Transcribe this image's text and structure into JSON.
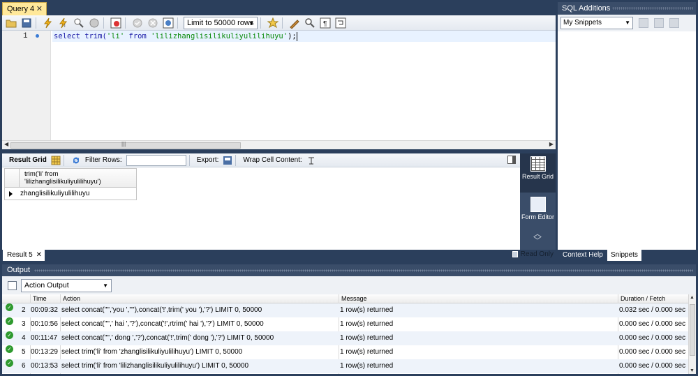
{
  "query_tab": {
    "label": "Query 4",
    "close": "✕"
  },
  "toolbar": {
    "limit_label": "Limit to 50000 rows",
    "icons": [
      "open-folder-icon",
      "save-icon",
      "execute-icon",
      "execute-current-icon",
      "explain-icon",
      "stop-icon",
      "toggle-error-icon",
      "commit-icon",
      "rollback-icon",
      "autocommit-icon",
      "beautify-icon",
      "find-icon",
      "invisible-chars-icon",
      "wrap-icon"
    ]
  },
  "editor": {
    "line_number": "1",
    "code": {
      "kw1": "select",
      "fn": " trim(",
      "s1": "'li'",
      "kw2": " from ",
      "s2": "'lilizhanglisilikuliyulilihuyu'",
      "tail": ");"
    }
  },
  "result_toolbar": {
    "result_grid": "Result Grid",
    "filter_rows": "Filter Rows:",
    "export": "Export:",
    "wrap_cell": "Wrap Cell Content:"
  },
  "result_grid": {
    "column_header": "trim('li' from 'lilizhanglisilikuliyulilihuyu')",
    "rows": [
      "zhanglisilikuliyulilihuyu"
    ]
  },
  "side_panel": {
    "result_grid_label": "Result Grid",
    "form_editor_label": "Form Editor"
  },
  "result_tab": {
    "label": "Result 5",
    "close": "✕",
    "read_only": "Read Only"
  },
  "sql_additions": {
    "title": "SQL Additions",
    "snippet_select": "My Snippets",
    "tab_context": "Context Help",
    "tab_snippets": "Snippets"
  },
  "output": {
    "title": "Output",
    "select": "Action Output",
    "headers": {
      "time": "Time",
      "action": "Action",
      "message": "Message",
      "duration": "Duration / Fetch"
    },
    "rows": [
      {
        "n": "2",
        "time": "00:09:32",
        "action": "select concat('\"','you ','\"'),concat('!',trim(' you '),'?') LIMIT 0, 50000",
        "message": "1 row(s) returned",
        "duration": "0.032 sec / 0.000 sec"
      },
      {
        "n": "3",
        "time": "00:10:56",
        "action": "select concat('\"',' hai ','?'),concat('!',rtrim(' hai '),'?') LIMIT 0, 50000",
        "message": "1 row(s) returned",
        "duration": "0.000 sec / 0.000 sec"
      },
      {
        "n": "4",
        "time": "00:11:47",
        "action": "select concat('\"',' dong ','?'),concat('!',trim(' dong '),'?') LIMIT 0, 50000",
        "message": "1 row(s) returned",
        "duration": "0.000 sec / 0.000 sec"
      },
      {
        "n": "5",
        "time": "00:13:29",
        "action": "select trim('li' from 'zhanglisilikuliyulilihuyu') LIMIT 0, 50000",
        "message": "1 row(s) returned",
        "duration": "0.000 sec / 0.000 sec"
      },
      {
        "n": "6",
        "time": "00:13:53",
        "action": "select trim('li' from 'lilizhanglisilikuliyulilihuyu') LIMIT 0, 50000",
        "message": "1 row(s) returned",
        "duration": "0.000 sec / 0.000 sec"
      }
    ]
  },
  "colors": {
    "frame": "#2b3f5c",
    "panel_header": "#3a4d69",
    "tab_active": "#ffe89a",
    "ok": "#2f9a2f"
  }
}
